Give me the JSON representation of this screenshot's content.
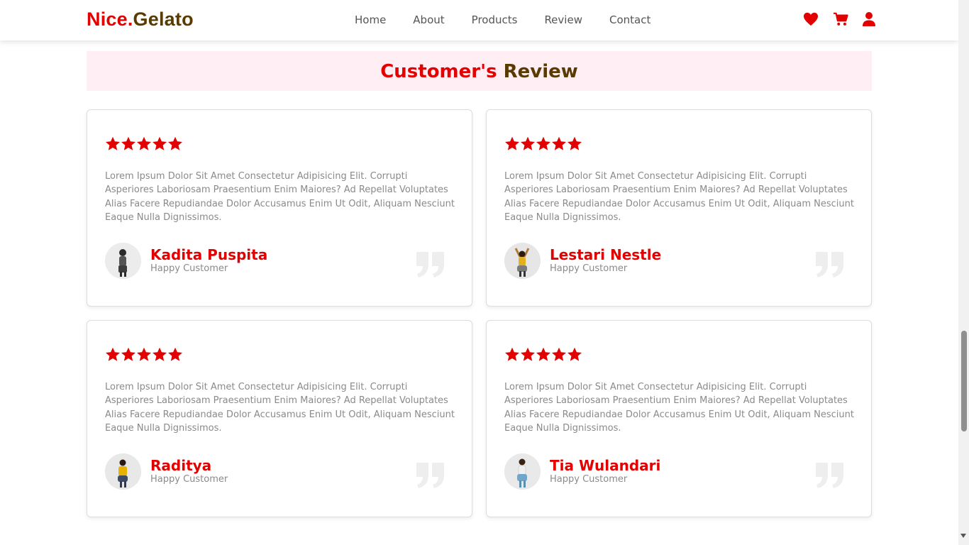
{
  "header": {
    "logo_part1": "Nice.",
    "logo_part2": "Gelato",
    "nav": [
      "Home",
      "About",
      "Products",
      "Review",
      "Contact"
    ],
    "icons": [
      "heart-icon",
      "cart-icon",
      "user-icon"
    ]
  },
  "section": {
    "title_part1": "Customer's",
    "title_part2": "Review"
  },
  "reviews": [
    {
      "rating": 5,
      "text": "Lorem Ipsum Dolor Sit Amet Consectetur Adipisicing Elit. Corrupti Asperiores Laboriosam Praesentium Enim Maiores? Ad Repellat Voluptates Alias Facere Repudiandae Dolor Accusamus Enim Ut Odit, Aliquam Nesciunt Eaque Nulla Dignissimos.",
      "name": "Kadita Puspita",
      "role": "Happy Customer"
    },
    {
      "rating": 5,
      "text": "Lorem Ipsum Dolor Sit Amet Consectetur Adipisicing Elit. Corrupti Asperiores Laboriosam Praesentium Enim Maiores? Ad Repellat Voluptates Alias Facere Repudiandae Dolor Accusamus Enim Ut Odit, Aliquam Nesciunt Eaque Nulla Dignissimos.",
      "name": "Lestari Nestle",
      "role": "Happy Customer"
    },
    {
      "rating": 5,
      "text": "Lorem Ipsum Dolor Sit Amet Consectetur Adipisicing Elit. Corrupti Asperiores Laboriosam Praesentium Enim Maiores? Ad Repellat Voluptates Alias Facere Repudiandae Dolor Accusamus Enim Ut Odit, Aliquam Nesciunt Eaque Nulla Dignissimos.",
      "name": "Raditya",
      "role": "Happy Customer"
    },
    {
      "rating": 5,
      "text": "Lorem Ipsum Dolor Sit Amet Consectetur Adipisicing Elit. Corrupti Asperiores Laboriosam Praesentium Enim Maiores? Ad Repellat Voluptates Alias Facere Repudiandae Dolor Accusamus Enim Ut Odit, Aliquam Nesciunt Eaque Nulla Dignissimos.",
      "name": "Tia Wulandari",
      "role": "Happy Customer"
    }
  ],
  "colors": {
    "accent": "#e30000",
    "brown": "#5a3a00",
    "section_bg": "#ffeef4",
    "muted_text": "#8a8a8a"
  }
}
